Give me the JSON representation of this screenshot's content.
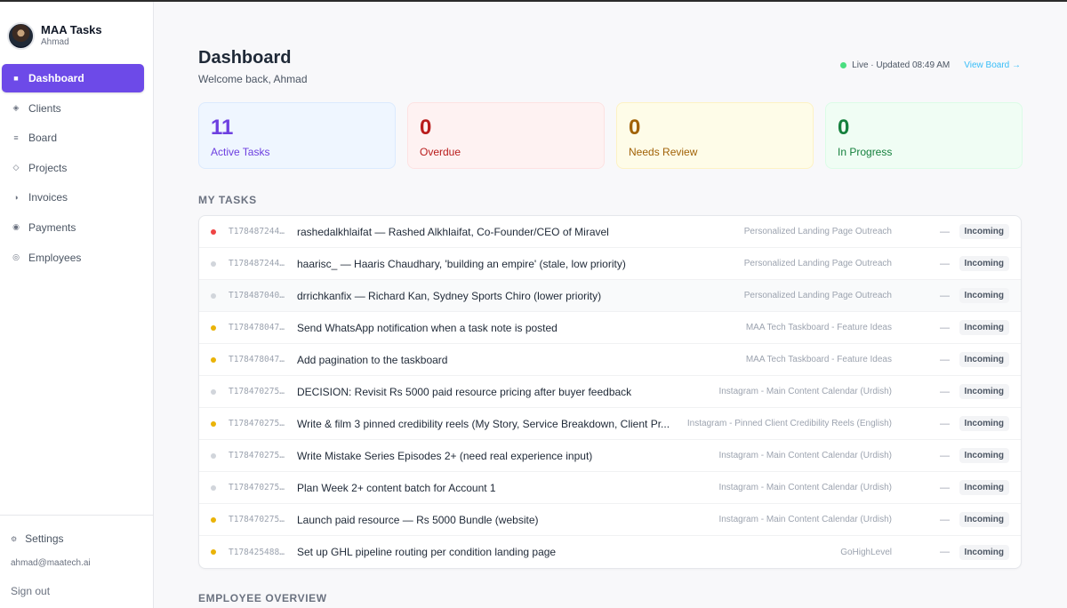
{
  "app": {
    "name": "MAA Tasks",
    "user": "Ahmad"
  },
  "nav": [
    {
      "label": "Dashboard",
      "icon": "square-icon",
      "glyph": "■",
      "active": true
    },
    {
      "label": "Clients",
      "icon": "diamond-icon",
      "glyph": "◈",
      "active": false
    },
    {
      "label": "Board",
      "icon": "lines-icon",
      "glyph": "≡",
      "active": false
    },
    {
      "label": "Projects",
      "icon": "diamond-outline-icon",
      "glyph": "◇",
      "active": false
    },
    {
      "label": "Invoices",
      "icon": "half-circle-icon",
      "glyph": "◑",
      "active": false
    },
    {
      "label": "Payments",
      "icon": "dot-circle-icon",
      "glyph": "◉",
      "active": false
    },
    {
      "label": "Employees",
      "icon": "ring-icon",
      "glyph": "◎",
      "active": false
    }
  ],
  "sidebar_footer": {
    "settings": "Settings",
    "settings_glyph": "⚙",
    "email": "ahmad@maatech.ai",
    "signout": "Sign out"
  },
  "header": {
    "title": "Dashboard",
    "subtitle": "Welcome back, Ahmad",
    "live_status": "Live · Updated 08:49 AM",
    "view_board": "View Board →"
  },
  "stats": [
    {
      "value": "11",
      "label": "Active Tasks"
    },
    {
      "value": "0",
      "label": "Overdue"
    },
    {
      "value": "0",
      "label": "Needs Review"
    },
    {
      "value": "0",
      "label": "In Progress"
    }
  ],
  "sections": {
    "my_tasks": "MY TASKS",
    "employee_overview": "EMPLOYEE OVERVIEW"
  },
  "colors": {
    "red": "#ef4444",
    "gray": "#d1d5db",
    "yellow": "#eab308",
    "accent": "#6d4ae8"
  },
  "tasks": [
    {
      "id": "T178487244…",
      "title": "rashedalkhlaifat — Rashed Alkhlaifat, Co-Founder/CEO of Miravel",
      "project": "Personalized Landing Page Outreach",
      "due": "—",
      "status": "Incoming",
      "priority": "red"
    },
    {
      "id": "T178487244…",
      "title": "haarisc_ — Haaris Chaudhary, 'building an empire' (stale, low priority)",
      "project": "Personalized Landing Page Outreach",
      "due": "—",
      "status": "Incoming",
      "priority": "gray"
    },
    {
      "id": "T178487040…",
      "title": "drrichkanfix — Richard Kan, Sydney Sports Chiro (lower priority)",
      "project": "Personalized Landing Page Outreach",
      "due": "—",
      "status": "Incoming",
      "priority": "gray"
    },
    {
      "id": "T178478047…",
      "title": "Send WhatsApp notification when a task note is posted",
      "project": "MAA Tech Taskboard - Feature Ideas",
      "due": "—",
      "status": "Incoming",
      "priority": "yellow"
    },
    {
      "id": "T178478047…",
      "title": "Add pagination to the taskboard",
      "project": "MAA Tech Taskboard - Feature Ideas",
      "due": "—",
      "status": "Incoming",
      "priority": "yellow"
    },
    {
      "id": "T178470275…",
      "title": "DECISION: Revisit Rs 5000 paid resource pricing after buyer feedback",
      "project": "Instagram - Main Content Calendar (Urdish)",
      "due": "—",
      "status": "Incoming",
      "priority": "gray"
    },
    {
      "id": "T178470275…",
      "title": "Write & film 3 pinned credibility reels (My Story, Service Breakdown, Client Pr...",
      "project": "Instagram - Pinned Client Credibility Reels (English)",
      "due": "—",
      "status": "Incoming",
      "priority": "yellow"
    },
    {
      "id": "T178470275…",
      "title": "Write Mistake Series Episodes 2+ (need real experience input)",
      "project": "Instagram - Main Content Calendar (Urdish)",
      "due": "—",
      "status": "Incoming",
      "priority": "gray"
    },
    {
      "id": "T178470275…",
      "title": "Plan Week 2+ content batch for Account 1",
      "project": "Instagram - Main Content Calendar (Urdish)",
      "due": "—",
      "status": "Incoming",
      "priority": "gray"
    },
    {
      "id": "T178470275…",
      "title": "Launch paid resource — Rs 5000 Bundle (website)",
      "project": "Instagram - Main Content Calendar (Urdish)",
      "due": "—",
      "status": "Incoming",
      "priority": "yellow"
    },
    {
      "id": "T178425488…",
      "title": "Set up GHL pipeline routing per condition landing page",
      "project": "GoHighLevel",
      "due": "—",
      "status": "Incoming",
      "priority": "yellow"
    }
  ]
}
